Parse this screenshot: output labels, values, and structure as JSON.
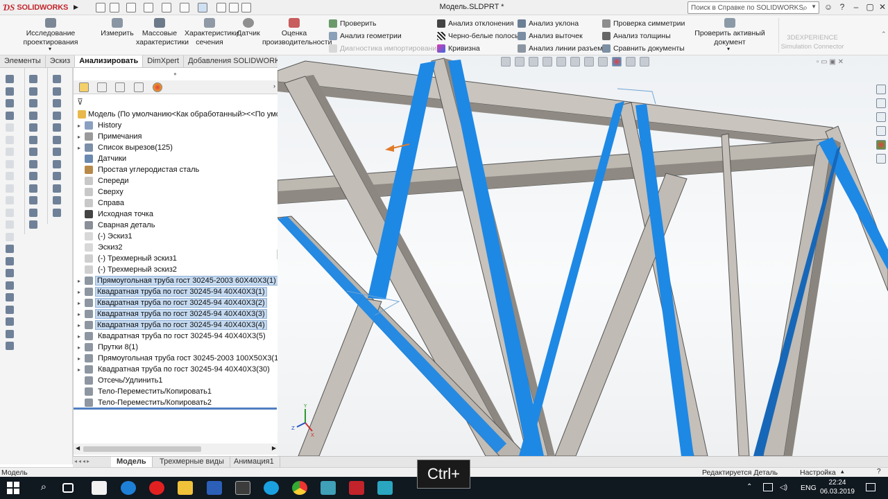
{
  "app": {
    "name": "SOLIDWORKS",
    "doc_title": "Модель.SLDPRT *"
  },
  "help_search": {
    "placeholder": "Поиск в Справке по SOLIDWORKS"
  },
  "ribbon": {
    "big_buttons": [
      {
        "label": "Исследование проектирования"
      },
      {
        "label": "Измерить"
      },
      {
        "label": "Массовые характеристики"
      },
      {
        "label": "Характеристики сечения"
      },
      {
        "label": "Датчик"
      },
      {
        "label": "Оценка производительности"
      }
    ],
    "col1": [
      "Проверить",
      "Анализ геометрии",
      "Диагностика импортирования"
    ],
    "col2": [
      "Анализ отклонения",
      "Черно-белые полосы",
      "Кривизна"
    ],
    "col3": [
      "Анализ уклона",
      "Анализ выточек",
      "Анализ линии разъема"
    ],
    "col4": [
      "Проверка симметрии",
      "Анализ толщины",
      "Сравнить документы"
    ],
    "check_active": "Проверить активный документ",
    "exp_line1": "3DEXPERIENCE",
    "exp_line2": "Simulation Connector"
  },
  "cm_tabs": [
    "Элементы",
    "Эскиз",
    "Анализировать",
    "DimXpert",
    "Добавления SOLIDWORKS"
  ],
  "tree": {
    "root": "Модель  (По умолчанию<Как обработанный><<По умолча",
    "items": [
      {
        "label": "History",
        "exp": true,
        "sel": false
      },
      {
        "label": "Примечания",
        "exp": true,
        "sel": false
      },
      {
        "label": "Список вырезов(125)",
        "exp": true,
        "sel": false
      },
      {
        "label": "Датчики",
        "exp": false,
        "sel": false
      },
      {
        "label": "Простая углеродистая сталь",
        "exp": false,
        "sel": false
      },
      {
        "label": "Спереди",
        "exp": false,
        "sel": false
      },
      {
        "label": "Сверху",
        "exp": false,
        "sel": false
      },
      {
        "label": "Справа",
        "exp": false,
        "sel": false
      },
      {
        "label": "Исходная точка",
        "exp": false,
        "sel": false
      },
      {
        "label": "Сварная деталь",
        "exp": false,
        "sel": false
      },
      {
        "label": "(-) Эскиз1",
        "exp": false,
        "sel": false
      },
      {
        "label": "Эскиз2",
        "exp": false,
        "sel": false
      },
      {
        "label": "(-) Трехмерный эскиз1",
        "exp": false,
        "sel": false
      },
      {
        "label": "(-) Трехмерный эскиз2",
        "exp": false,
        "sel": false
      },
      {
        "label": "Прямоугольная труба гост 30245-2003 60X40X3(1)",
        "exp": true,
        "sel": true
      },
      {
        "label": "Квадратная труба по гост 30245-94 40X40X3(1)",
        "exp": true,
        "sel": true
      },
      {
        "label": "Квадратная труба по гост 30245-94 40X40X3(2)",
        "exp": true,
        "sel": true
      },
      {
        "label": "Квадратная труба по гост 30245-94 40X40X3(3)",
        "exp": true,
        "sel": true
      },
      {
        "label": "Квадратная труба по гост 30245-94 40X40X3(4)",
        "exp": true,
        "sel": true
      },
      {
        "label": "Квадратная труба по гост 30245-94 40X40X3(5)",
        "exp": true,
        "sel": false
      },
      {
        "label": "Прутки 8(1)",
        "exp": true,
        "sel": false
      },
      {
        "label": "Прямоугольная труба гост 30245-2003 100X50X3(1)",
        "exp": true,
        "sel": false
      },
      {
        "label": "Квадратная труба по гост 30245-94 40X40X3(30)",
        "exp": true,
        "sel": false
      },
      {
        "label": "Отсечь/Удлинить1",
        "exp": false,
        "sel": false
      },
      {
        "label": "Тело-Переместить/Копировать1",
        "exp": false,
        "sel": false
      },
      {
        "label": "Тело-Переместить/Копировать2",
        "exp": false,
        "sel": false
      }
    ]
  },
  "bottom_tabs": [
    "Модель",
    "Трехмерные виды",
    "Анимация1"
  ],
  "status": {
    "left": "Модель",
    "editing": "Редактируется Деталь",
    "settings": "Настройка"
  },
  "keyhint": "Ctrl+",
  "taskbar": {
    "lang": "ENG",
    "time": "22:24",
    "date": "06.03.2019"
  },
  "colors": {
    "highlight_blue": "#1e88e5",
    "steel": "#b7b2ab",
    "selection": "#c4d9f0"
  }
}
